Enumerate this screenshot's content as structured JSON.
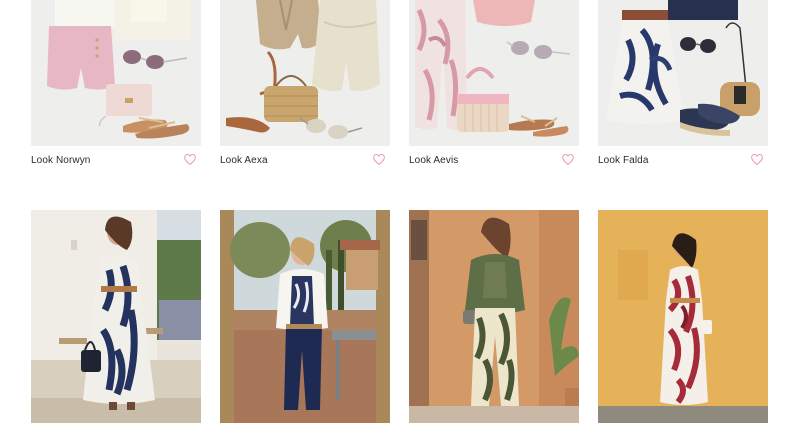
{
  "looks": [
    {
      "name": "Look Norwyn"
    },
    {
      "name": "Look Aexa"
    },
    {
      "name": "Look Aevis"
    },
    {
      "name": "Look Falda"
    }
  ],
  "photos": [
    {
      "alt": ""
    },
    {
      "alt": ""
    },
    {
      "alt": ""
    },
    {
      "alt": ""
    }
  ],
  "colors": {
    "heart": "#e8a0a8",
    "thumb_bg": "#eeeeec"
  },
  "icons": {
    "favorite": "heart-icon"
  }
}
